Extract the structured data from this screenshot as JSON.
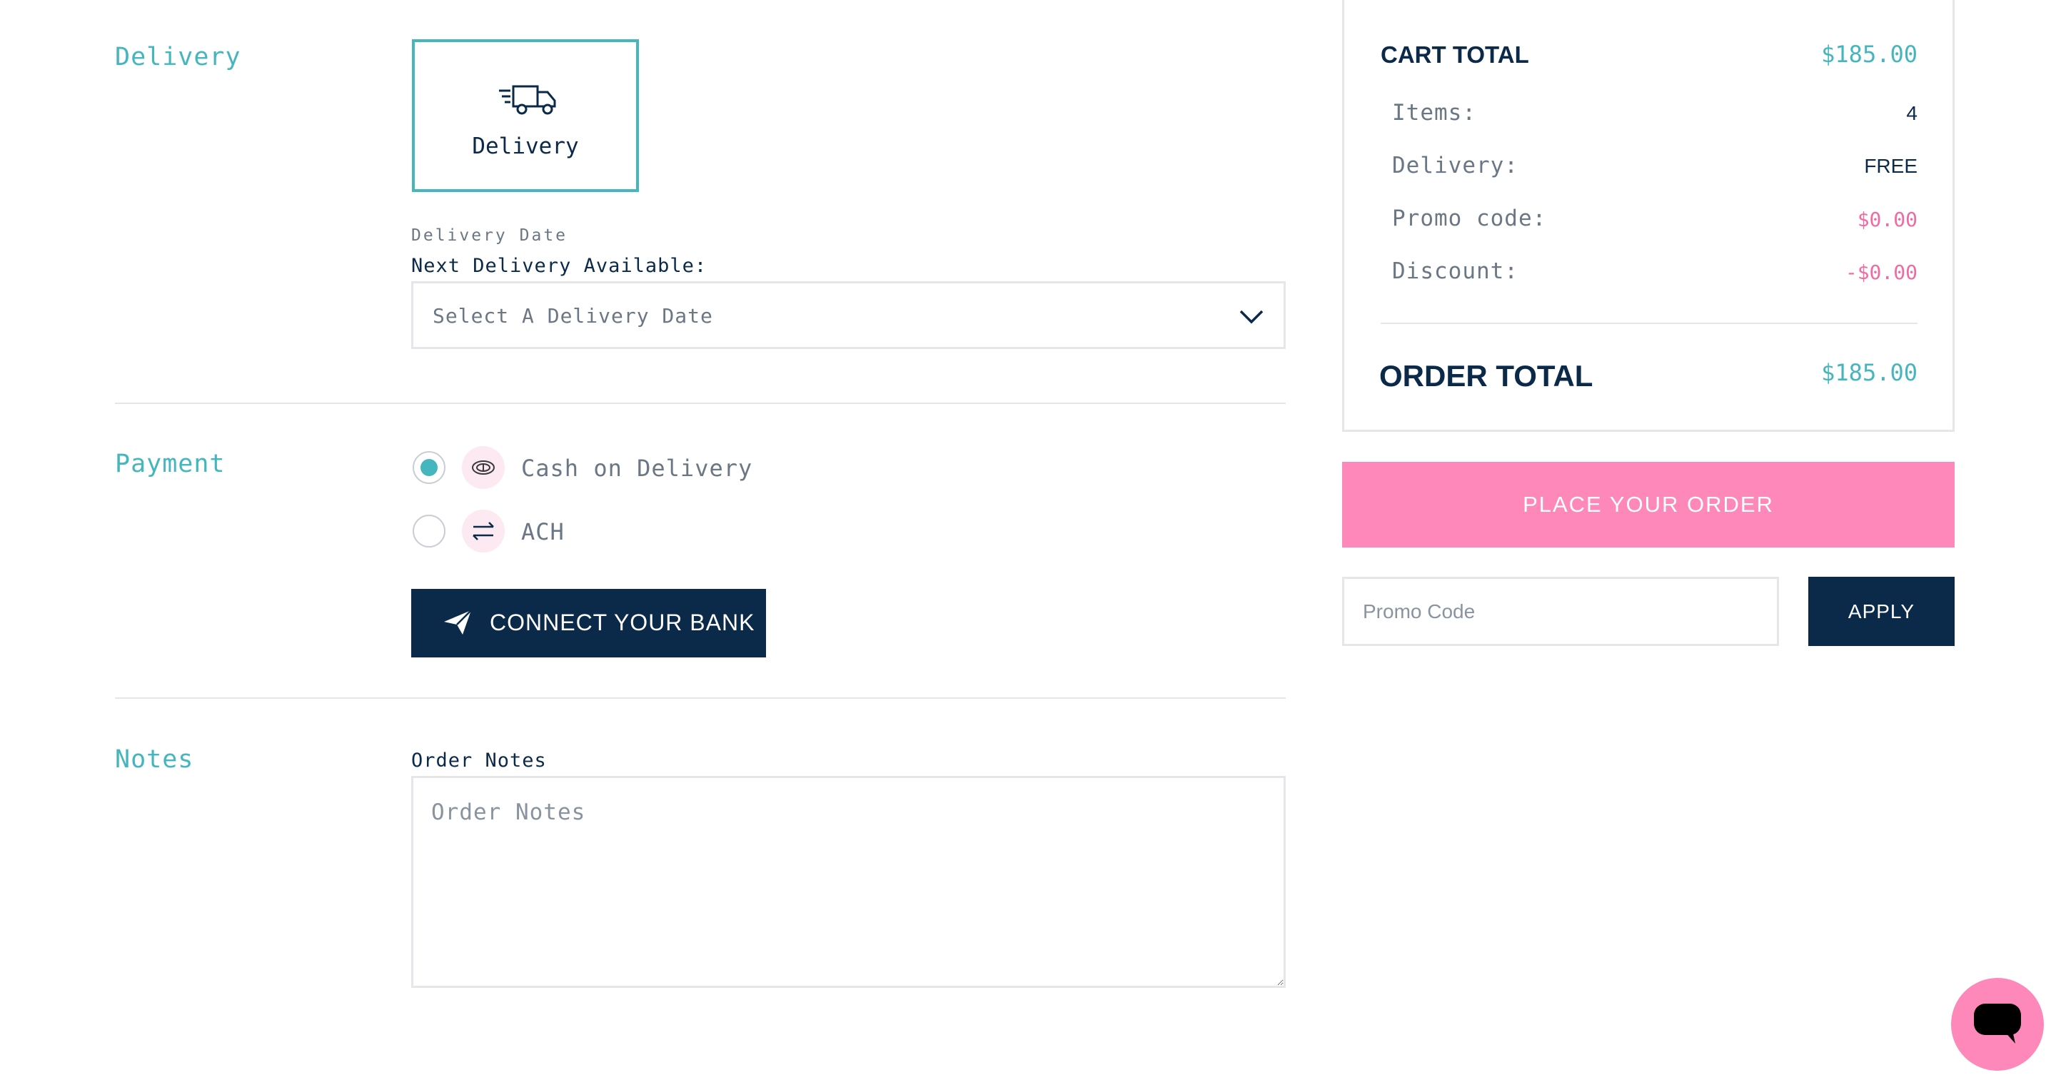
{
  "sections": {
    "delivery": "Delivery",
    "payment": "Payment",
    "notes": "Notes"
  },
  "delivery": {
    "option_label": "Delivery",
    "date_label": "Delivery Date",
    "next_available_label": "Next Delivery Available:",
    "select_placeholder": "Select A Delivery Date"
  },
  "payment": {
    "options": [
      {
        "label": "Cash on Delivery",
        "icon": "cash-icon",
        "selected": true
      },
      {
        "label": "ACH",
        "icon": "transfer-arrows-icon",
        "selected": false
      }
    ],
    "connect_button": "CONNECT YOUR BANK"
  },
  "notes": {
    "label": "Order Notes",
    "placeholder": "Order Notes"
  },
  "summary": {
    "cart_total_label": "CART TOTAL",
    "cart_total_value": "$185.00",
    "rows": [
      {
        "label": "Items:",
        "value": "4"
      },
      {
        "label": "Delivery:",
        "value": "FREE"
      },
      {
        "label": "Promo code:",
        "value": "$0.00"
      },
      {
        "label": "Discount:",
        "value": "-$0.00"
      }
    ],
    "order_total_label": "ORDER TOTAL",
    "order_total_value": "$185.00"
  },
  "actions": {
    "place_order": "PLACE YOUR ORDER",
    "promo_placeholder": "Promo Code",
    "apply": "APPLY"
  },
  "colors": {
    "teal": "#45b6be",
    "navy": "#0b2a4a",
    "pink": "#fd88b9",
    "pink_text": "#f06ba4",
    "border": "#e4e6ea"
  }
}
